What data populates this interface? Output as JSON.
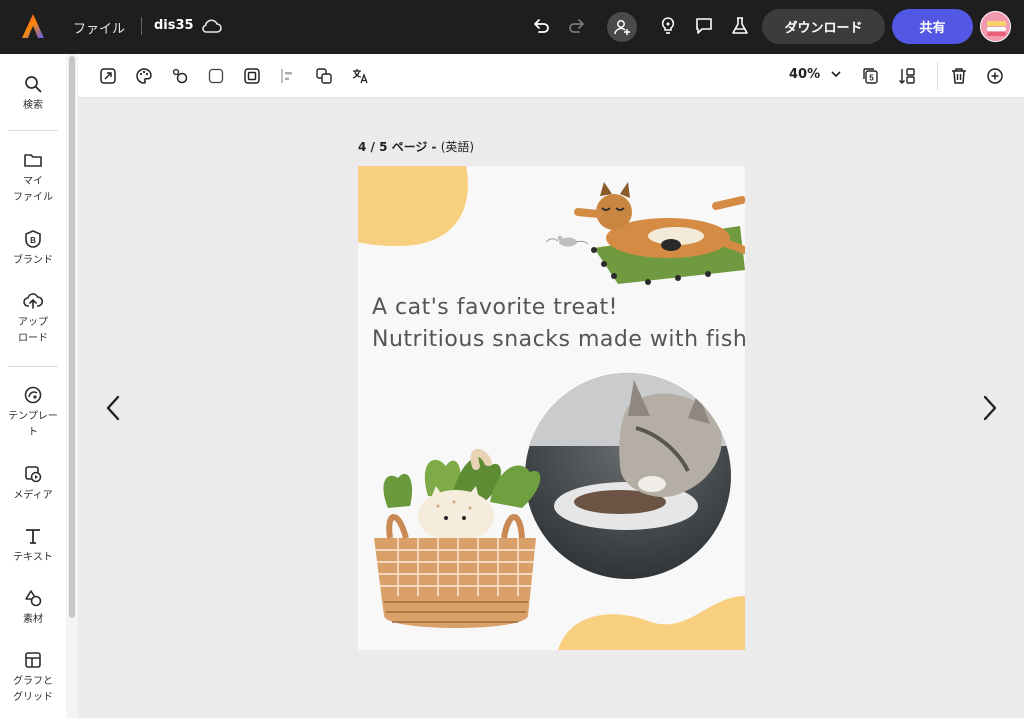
{
  "topbar": {
    "file_menu": "ファイル",
    "doc_name": "dis35",
    "download_label": "ダウンロード",
    "share_label": "共有"
  },
  "sidebar": {
    "items": [
      {
        "label": "検索",
        "icon": "search-icon"
      },
      {
        "label": "マイ\nファイル",
        "icon": "folder-icon"
      },
      {
        "label": "ブランド",
        "icon": "brand-icon"
      },
      {
        "label": "アップ\nロード",
        "icon": "upload-icon"
      },
      {
        "label": "テンプレー\nト",
        "icon": "template-icon"
      },
      {
        "label": "メディア",
        "icon": "media-icon"
      },
      {
        "label": "テキスト",
        "icon": "text-icon"
      },
      {
        "label": "素材",
        "icon": "elements-icon"
      },
      {
        "label": "グラフと\nグリッド",
        "icon": "grid-icon"
      }
    ]
  },
  "toolbar": {
    "zoom": "40%"
  },
  "canvas": {
    "page_indicator": "4 / 5 ページ - ",
    "page_language": "(英語)",
    "headline_line1": "A cat's favorite treat!",
    "headline_line2": "Nutritious snacks made with fish"
  },
  "colors": {
    "share": "#5258e4",
    "accent_yellow": "#f7cf7e",
    "topbar": "#1e1e1e"
  }
}
